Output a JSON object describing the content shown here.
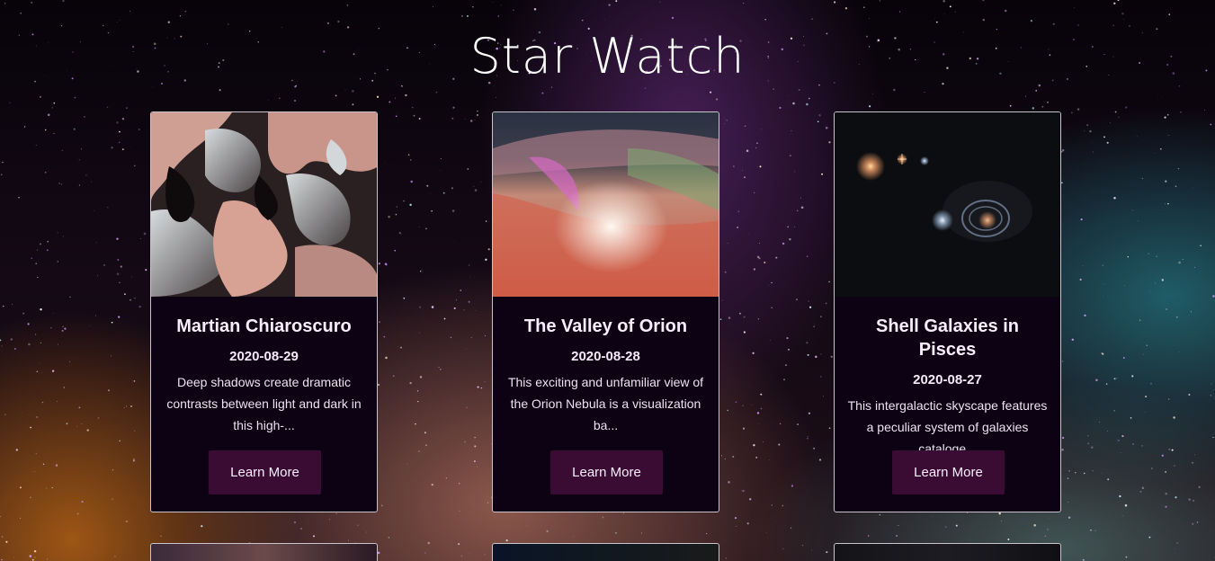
{
  "page": {
    "title": "Star Watch"
  },
  "cards": [
    {
      "title": "Martian Chiaroscuro",
      "date": "2020-08-29",
      "description": "Deep shadows create dramatic contrasts between light and dark in this high-...",
      "button_label": "Learn More"
    },
    {
      "title": "The Valley of Orion",
      "date": "2020-08-28",
      "description": "This exciting and unfamiliar view of the Orion Nebula is a visualization ba...",
      "button_label": "Learn More"
    },
    {
      "title": "Shell Galaxies in Pisces",
      "date": "2020-08-27",
      "description": "This intergalactic skyscape features a peculiar system of galaxies cataloge...",
      "button_label": "Learn More"
    }
  ],
  "colors": {
    "card_background": "#0d0214",
    "button_background": "#3a0b33",
    "card_border": "#c9c3cc"
  }
}
